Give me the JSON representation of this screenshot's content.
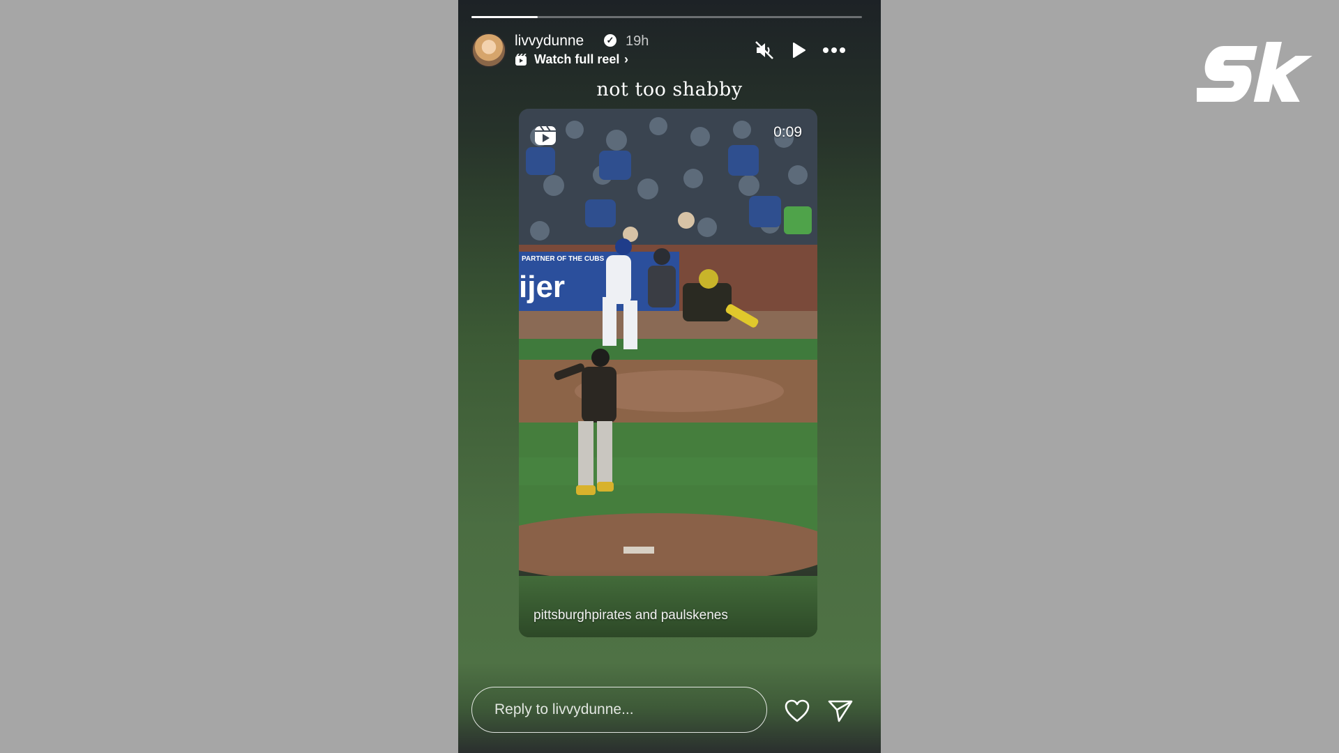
{
  "story": {
    "progress_fraction": 0.17,
    "user": {
      "username": "livvydunne",
      "verified": true,
      "time_ago": "19h",
      "avatar_icon": "avatar-photo"
    },
    "watch_full_reel_label": "Watch full reel",
    "header_icons": [
      "reel-icon",
      "chevron-right-icon",
      "speaker-muted-icon",
      "play-icon",
      "more-horizontal-icon"
    ],
    "caption": "not too shabby",
    "reel": {
      "duration": "0:09",
      "credit": "pittsburghpirates and paulskenes",
      "scene_signage": "ijer",
      "scene_banner": "PARTNER OF THE CUBS"
    },
    "reply_placeholder": "Reply to livvydunne...",
    "footer_icons": [
      "heart-icon",
      "send-icon"
    ]
  },
  "watermark": {
    "brand": "sk"
  },
  "colors": {
    "page_background": "#a6a6a6",
    "story_top": "#1d2226",
    "story_green": "#4b6e42",
    "text": "#ffffff"
  }
}
